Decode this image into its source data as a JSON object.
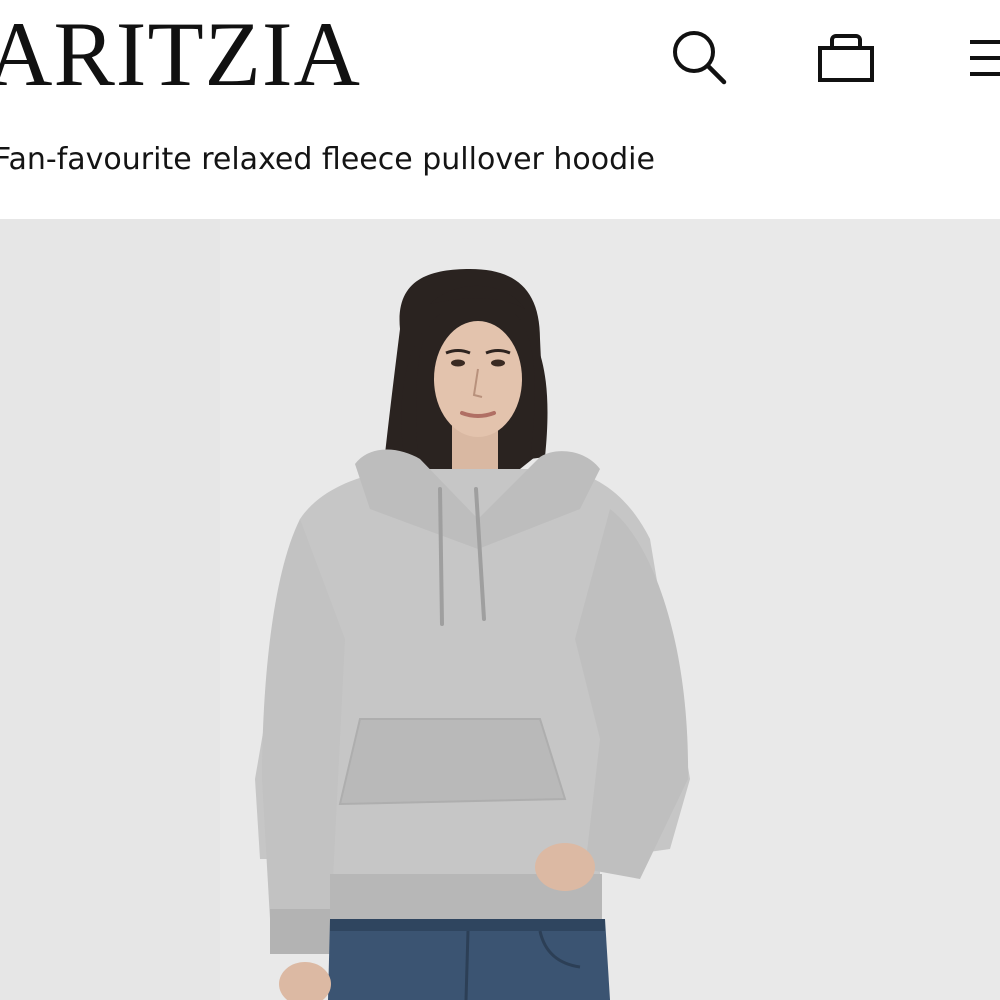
{
  "brand": {
    "logo_text": "ARITZIA"
  },
  "header": {
    "icons": [
      "search-icon",
      "shopping-bag-icon",
      "menu-icon"
    ]
  },
  "product": {
    "subtitle": "Fan-favourite relaxed fleece pullover hoodie"
  },
  "colors": {
    "background": "#ffffff",
    "text": "#111111",
    "hero_background": "#e9e9e9",
    "hoodie": "#c9c9c9",
    "denim": "#3b5472",
    "hair": "#2a2320"
  }
}
